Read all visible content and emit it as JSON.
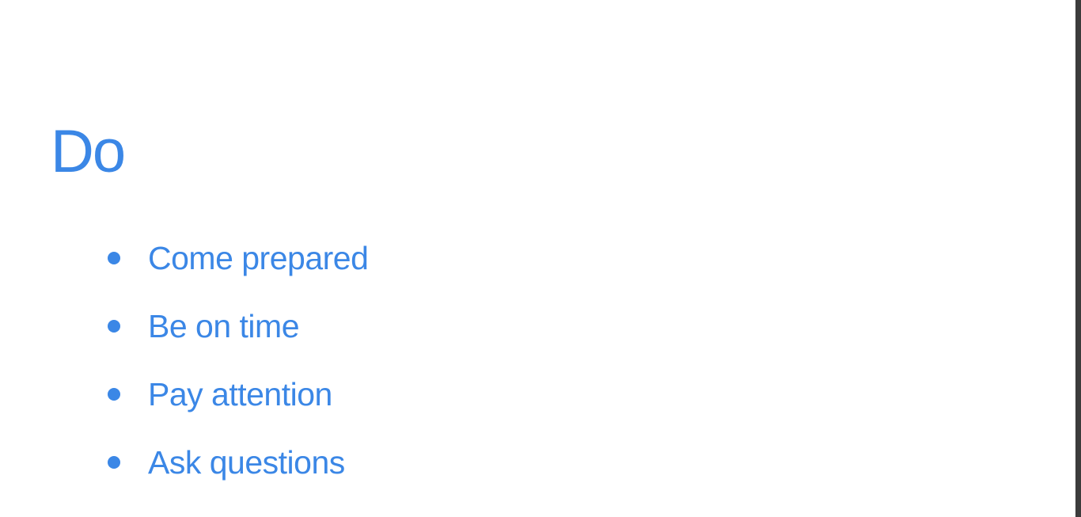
{
  "slide": {
    "title": "Do",
    "bullets": [
      {
        "text": "Come prepared"
      },
      {
        "text": "Be on time"
      },
      {
        "text": "Pay attention"
      },
      {
        "text": "Ask questions"
      }
    ]
  },
  "colors": {
    "accent": "#3b87e6",
    "background": "#ffffff"
  }
}
